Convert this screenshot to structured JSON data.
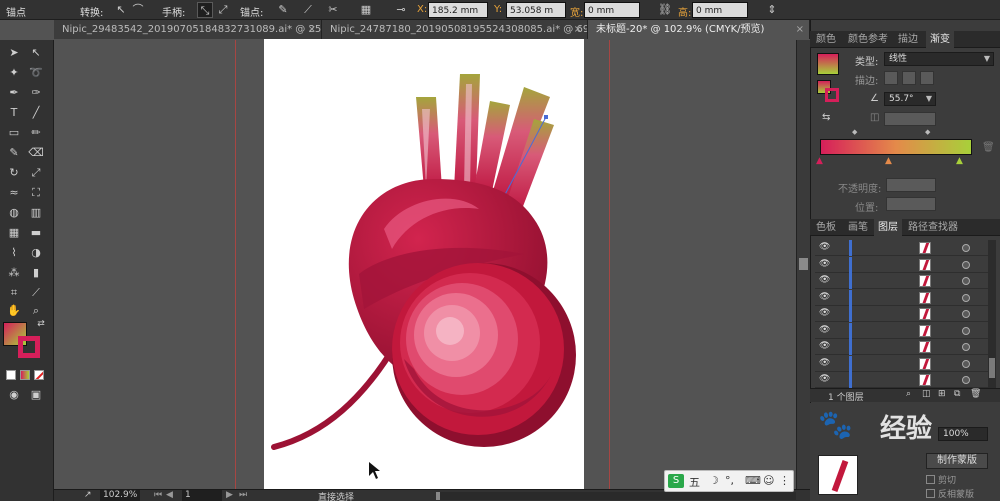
{
  "control_bar": {
    "mode_label": "锚点",
    "convert_label": "转换:",
    "handle_label": "手柄:",
    "anchor_label": "锚点:",
    "x_label": "X:",
    "x_value": "185.2 mm",
    "y_label": "Y:",
    "y_value": "53.058 m",
    "w_label": "宽:",
    "w_value": "0 mm",
    "h_label": "高:",
    "h_value": "0 mm"
  },
  "tabs": [
    {
      "label": "Nipic_29483542_20190705184832731089.ai* @ 25..."
    },
    {
      "label": "Nipic_24787180_20190508195524308085.ai* @ 69..."
    },
    {
      "label": "未标题-20* @ 102.9% (CMYK/预览)"
    }
  ],
  "gradient_panel": {
    "tabs": [
      "颜色",
      "颜色参考",
      "描边",
      "渐变"
    ],
    "type_label": "类型:",
    "type_value": "线性",
    "stroke_label": "描边:",
    "angle_value": "55.7°",
    "opacity_label": "不透明度:",
    "position_label": "位置:",
    "stops": [
      "#d61f5a",
      "#e48a4a",
      "#a8d03a"
    ]
  },
  "layers_panel": {
    "tabs": [
      "色板",
      "画笔",
      "图层",
      "路径查找器"
    ],
    "row_count": 9,
    "footer": "1 个图层"
  },
  "transparency_panel": {
    "opacity_value": "100%",
    "make_mask_label": "制作蒙版",
    "clip_label": "剪切",
    "invert_label": "反相蒙版"
  },
  "status_bar": {
    "zoom": "102.9%",
    "page": "1",
    "tool_name": "直接选择"
  },
  "ime": {
    "label": "五"
  },
  "watermark": {
    "text": "经验"
  },
  "colors": {
    "beet_dark": "#8e0f2e",
    "beet_mid": "#c2183c",
    "beet_light": "#e85a82",
    "stem_green": "#a4a53c",
    "guide_red": "#c2413d"
  }
}
